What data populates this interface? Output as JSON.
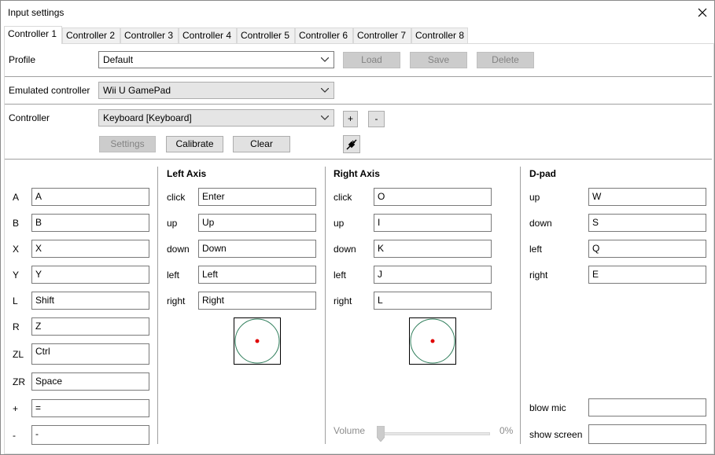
{
  "window": {
    "title": "Input settings",
    "close_icon": "close-icon"
  },
  "tabs": [
    "Controller 1",
    "Controller 2",
    "Controller 3",
    "Controller 4",
    "Controller 5",
    "Controller 6",
    "Controller 7",
    "Controller 8"
  ],
  "active_tab": 0,
  "profile": {
    "label": "Profile",
    "value": "Default",
    "load": "Load",
    "save": "Save",
    "delete": "Delete"
  },
  "emulated": {
    "label": "Emulated controller",
    "value": "Wii U GamePad"
  },
  "controller": {
    "label": "Controller",
    "value": "Keyboard [Keyboard]",
    "add": "+",
    "remove": "-",
    "settings": "Settings",
    "calibrate": "Calibrate",
    "clear": "Clear",
    "connect_icon": "connect-plug-icon"
  },
  "buttons": [
    {
      "name": "A",
      "value": "A"
    },
    {
      "name": "B",
      "value": "B"
    },
    {
      "name": "X",
      "value": "X"
    },
    {
      "name": "Y",
      "value": "Y"
    },
    {
      "name": "L",
      "value": "Shift"
    },
    {
      "name": "R",
      "value": "Z"
    },
    {
      "name": "ZL",
      "value": "Ctrl"
    },
    {
      "name": "ZR",
      "value": "Space"
    },
    {
      "name": "+",
      "value": "="
    },
    {
      "name": "-",
      "value": "-"
    }
  ],
  "left_axis": {
    "title": "Left Axis",
    "rows": [
      {
        "name": "click",
        "value": "Enter"
      },
      {
        "name": "up",
        "value": "Up"
      },
      {
        "name": "down",
        "value": "Down"
      },
      {
        "name": "left",
        "value": "Left"
      },
      {
        "name": "right",
        "value": "Right"
      }
    ]
  },
  "right_axis": {
    "title": "Right Axis",
    "rows": [
      {
        "name": "click",
        "value": "O"
      },
      {
        "name": "up",
        "value": "I"
      },
      {
        "name": "down",
        "value": "K"
      },
      {
        "name": "left",
        "value": "J"
      },
      {
        "name": "right",
        "value": "L"
      }
    ]
  },
  "dpad": {
    "title": "D-pad",
    "rows": [
      {
        "name": "up",
        "value": "W"
      },
      {
        "name": "down",
        "value": "S"
      },
      {
        "name": "left",
        "value": "Q"
      },
      {
        "name": "right",
        "value": "E"
      }
    ]
  },
  "extra": {
    "blow_mic_label": "blow mic",
    "blow_mic_value": "",
    "show_screen_label": "show screen",
    "show_screen_value": ""
  },
  "volume": {
    "label": "Volume",
    "value_text": "0%",
    "level": 0
  },
  "colors": {
    "axis_circle": "#2e7d5a",
    "axis_dot": "#e00000"
  }
}
